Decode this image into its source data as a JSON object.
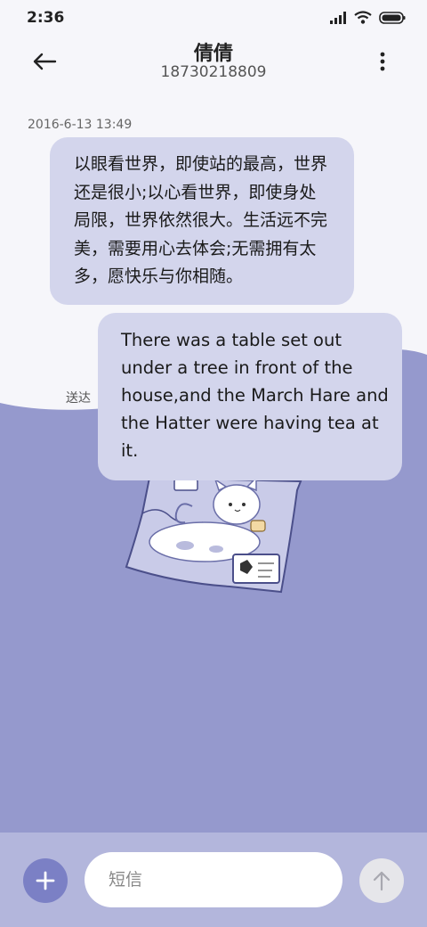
{
  "status_bar": {
    "time": "2:36",
    "icons": [
      "signal-icon",
      "wifi-icon",
      "battery-icon"
    ]
  },
  "header": {
    "back_icon": "arrow-left-icon",
    "contact_name": "倩倩",
    "contact_number": "18730218809",
    "more_icon": "more-vertical-icon"
  },
  "conversation": {
    "timestamp": "2016-6-13 13:49",
    "incoming_lines": [
      "以眼看世界，即使站的最高，世界",
      "还是很小;以心看世界，即使身处",
      "局限，世界依然很大。生活远不完",
      "美，需要用心去体会;无需拥有太",
      "多，愿快乐与你相随。"
    ],
    "outgoing_lines": [
      "There was a table set out",
      "under a tree in front of the",
      "house,and the March Hare and",
      "the Hatter were having tea at",
      "it."
    ],
    "delivered_label": "送达"
  },
  "composer": {
    "add_icon": "plus-icon",
    "placeholder": "短信",
    "value": "",
    "send_icon": "arrow-up-icon"
  },
  "colors": {
    "wallpaper": "#9599cd",
    "background": "#f6f6fa",
    "bubble": "#d3d5ec",
    "composer_bar": "#b3b6dc",
    "accent": "#7b80c5"
  }
}
